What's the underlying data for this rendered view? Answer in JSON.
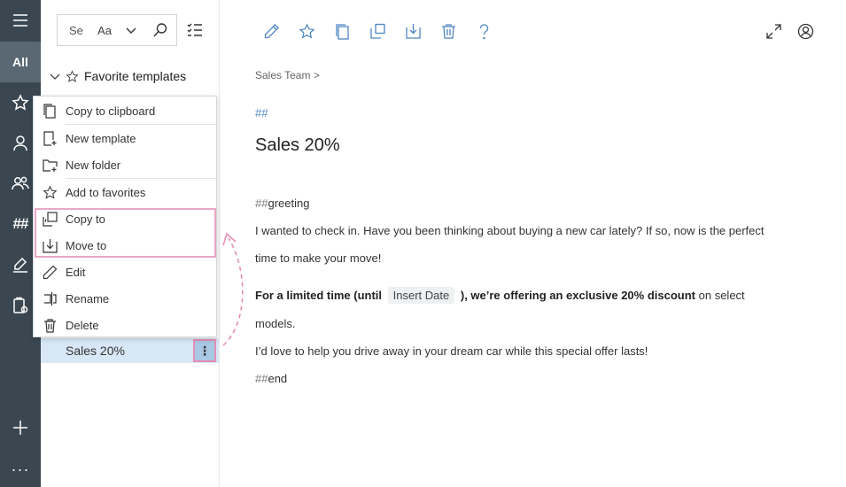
{
  "rail": {
    "all_label": "All",
    "hash_label": "##",
    "more_label": "···",
    "icons": [
      "hamburger-icon",
      "star-icon",
      "person-icon",
      "people-icon",
      "signature-icon",
      "clipboard-gear-icon",
      "plus-icon"
    ]
  },
  "panel": {
    "search_placeholder": "Se",
    "case_toggle": "Aa",
    "favorites_label": "Favorite templates",
    "selected_item": "Sales 20%"
  },
  "menu": {
    "items": [
      {
        "label": "Copy to clipboard",
        "icon": "clipboard-copy-icon"
      },
      {
        "label": "New template",
        "icon": "new-template-icon"
      },
      {
        "label": "New folder",
        "icon": "new-folder-icon"
      },
      {
        "label": "Add to favorites",
        "icon": "star-icon"
      },
      {
        "label": "Copy to",
        "icon": "copy-to-icon"
      },
      {
        "label": "Move to",
        "icon": "move-to-icon"
      },
      {
        "label": "Edit",
        "icon": "pencil-icon"
      },
      {
        "label": "Rename",
        "icon": "rename-icon"
      },
      {
        "label": "Delete",
        "icon": "trash-icon"
      }
    ]
  },
  "toolbar": {
    "icons": [
      "pencil-icon",
      "star-icon",
      "copy-icon",
      "copy-to-icon",
      "move-to-icon",
      "trash-icon",
      "help-icon",
      "expand-icon",
      "account-icon"
    ]
  },
  "content": {
    "breadcrumb": "Sales Team >",
    "hash_top": "##",
    "title": "Sales 20%",
    "greeting_hash": "##",
    "greeting_word": "greeting",
    "line1": "I wanted to check in. Have you been thinking about buying a new car lately? If so, now is the perfect",
    "line2": "time to make your move!",
    "bold1": "For a limited time (until",
    "chip": "Insert Date",
    "bold2": "), we’re offering an exclusive 20% discount",
    "tail": "on select",
    "line4": "models.",
    "line5": "I’d love to help you drive away in your dream car while this special offer lasts!",
    "end_hash": "##",
    "end_word": "end"
  },
  "colors": {
    "rail_bg": "#3a4750",
    "accent": "#4f86c4",
    "highlight_border": "#e9a7c6",
    "selected_row": "#d8e7f5"
  }
}
